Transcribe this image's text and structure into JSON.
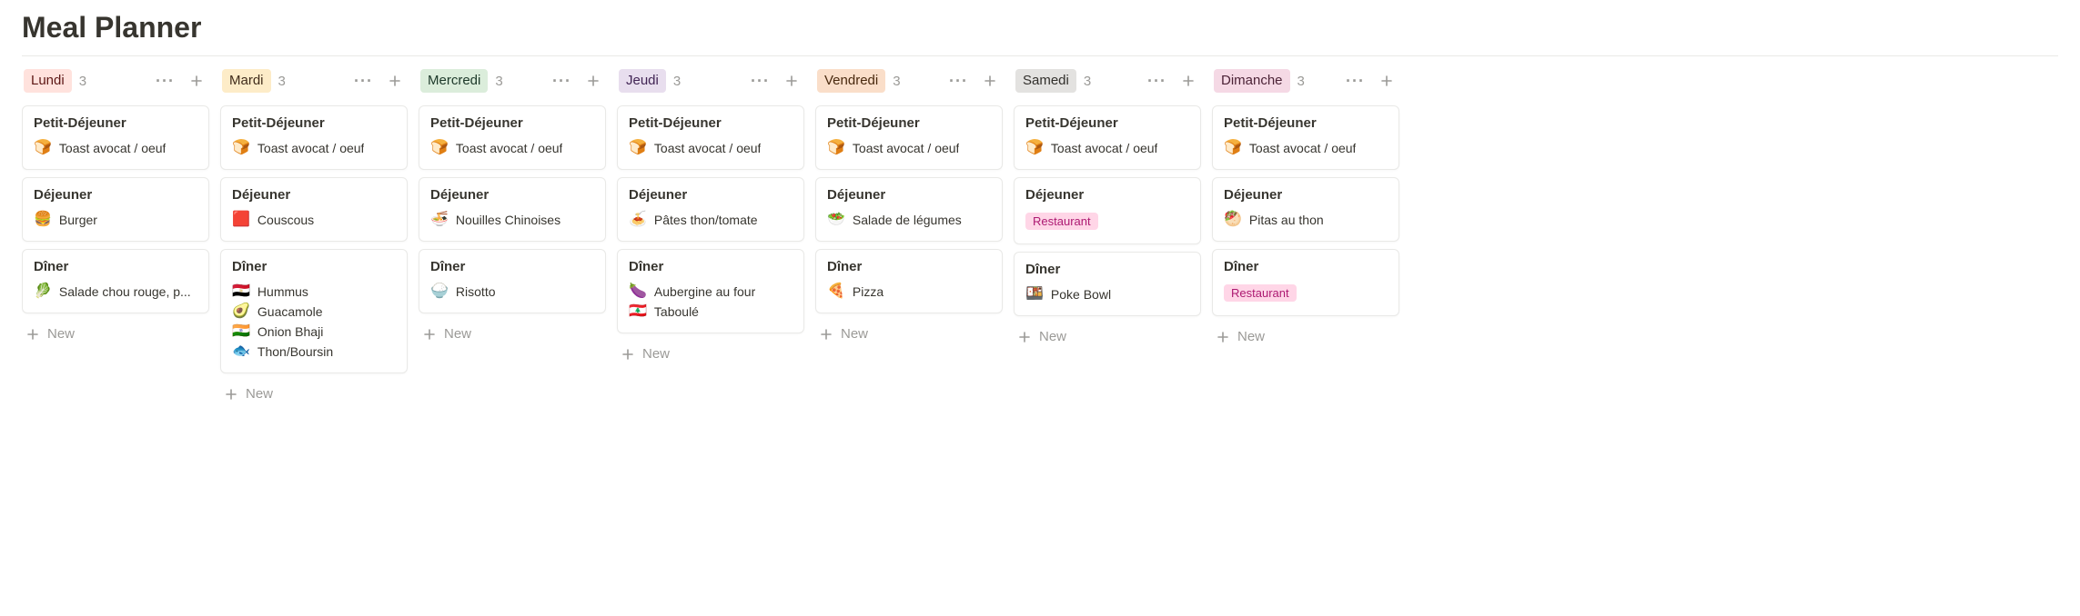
{
  "page": {
    "title": "Meal Planner",
    "new_label": "New"
  },
  "columns": [
    {
      "name": "Lundi",
      "count": 3,
      "color_class": "day-red",
      "cards": [
        {
          "title": "Petit-Déjeuner",
          "items": [
            {
              "emoji": "🍞",
              "label": "Toast avocat / oeuf"
            }
          ]
        },
        {
          "title": "Déjeuner",
          "items": [
            {
              "emoji": "🍔",
              "label": "Burger"
            }
          ]
        },
        {
          "title": "Dîner",
          "items": [
            {
              "emoji": "🥬",
              "label": "Salade chou rouge, p..."
            }
          ]
        }
      ]
    },
    {
      "name": "Mardi",
      "count": 3,
      "color_class": "day-yellow",
      "cards": [
        {
          "title": "Petit-Déjeuner",
          "items": [
            {
              "emoji": "🍞",
              "label": "Toast avocat / oeuf"
            }
          ]
        },
        {
          "title": "Déjeuner",
          "items": [
            {
              "emoji": "🟥",
              "label": "Couscous"
            }
          ]
        },
        {
          "title": "Dîner",
          "items": [
            {
              "emoji": "🇪🇬",
              "label": "Hummus"
            },
            {
              "emoji": "🥑",
              "label": "Guacamole"
            },
            {
              "emoji": "🇮🇳",
              "label": "Onion Bhaji"
            },
            {
              "emoji": "🐟",
              "label": "Thon/Boursin"
            }
          ]
        }
      ]
    },
    {
      "name": "Mercredi",
      "count": 3,
      "color_class": "day-green",
      "cards": [
        {
          "title": "Petit-Déjeuner",
          "items": [
            {
              "emoji": "🍞",
              "label": "Toast avocat / oeuf"
            }
          ]
        },
        {
          "title": "Déjeuner",
          "items": [
            {
              "emoji": "🍜",
              "label": "Nouilles Chinoises"
            }
          ]
        },
        {
          "title": "Dîner",
          "items": [
            {
              "emoji": "🍚",
              "label": "Risotto"
            }
          ]
        }
      ]
    },
    {
      "name": "Jeudi",
      "count": 3,
      "color_class": "day-purple",
      "cards": [
        {
          "title": "Petit-Déjeuner",
          "items": [
            {
              "emoji": "🍞",
              "label": "Toast avocat / oeuf"
            }
          ]
        },
        {
          "title": "Déjeuner",
          "items": [
            {
              "emoji": "🍝",
              "label": "Pâtes thon/tomate"
            }
          ]
        },
        {
          "title": "Dîner",
          "items": [
            {
              "emoji": "🍆",
              "label": "Aubergine au four"
            },
            {
              "emoji": "🇱🇧",
              "label": "Taboulé"
            }
          ]
        }
      ]
    },
    {
      "name": "Vendredi",
      "count": 3,
      "color_class": "day-orange",
      "cards": [
        {
          "title": "Petit-Déjeuner",
          "items": [
            {
              "emoji": "🍞",
              "label": "Toast avocat / oeuf"
            }
          ]
        },
        {
          "title": "Déjeuner",
          "items": [
            {
              "emoji": "🥗",
              "label": "Salade de légumes"
            }
          ]
        },
        {
          "title": "Dîner",
          "items": [
            {
              "emoji": "🍕",
              "label": "Pizza"
            }
          ]
        }
      ]
    },
    {
      "name": "Samedi",
      "count": 3,
      "color_class": "day-gray",
      "cards": [
        {
          "title": "Petit-Déjeuner",
          "items": [
            {
              "emoji": "🍞",
              "label": "Toast avocat / oeuf"
            }
          ]
        },
        {
          "title": "Déjeuner",
          "items": [
            {
              "tag": "Restaurant"
            }
          ]
        },
        {
          "title": "Dîner",
          "items": [
            {
              "emoji": "🍱",
              "label": "Poke Bowl"
            }
          ]
        }
      ]
    },
    {
      "name": "Dimanche",
      "count": 3,
      "color_class": "day-pink",
      "cards": [
        {
          "title": "Petit-Déjeuner",
          "items": [
            {
              "emoji": "🍞",
              "label": "Toast avocat / oeuf"
            }
          ]
        },
        {
          "title": "Déjeuner",
          "items": [
            {
              "emoji": "🥙",
              "label": "Pitas au thon"
            }
          ]
        },
        {
          "title": "Dîner",
          "items": [
            {
              "tag": "Restaurant"
            }
          ]
        }
      ]
    }
  ]
}
